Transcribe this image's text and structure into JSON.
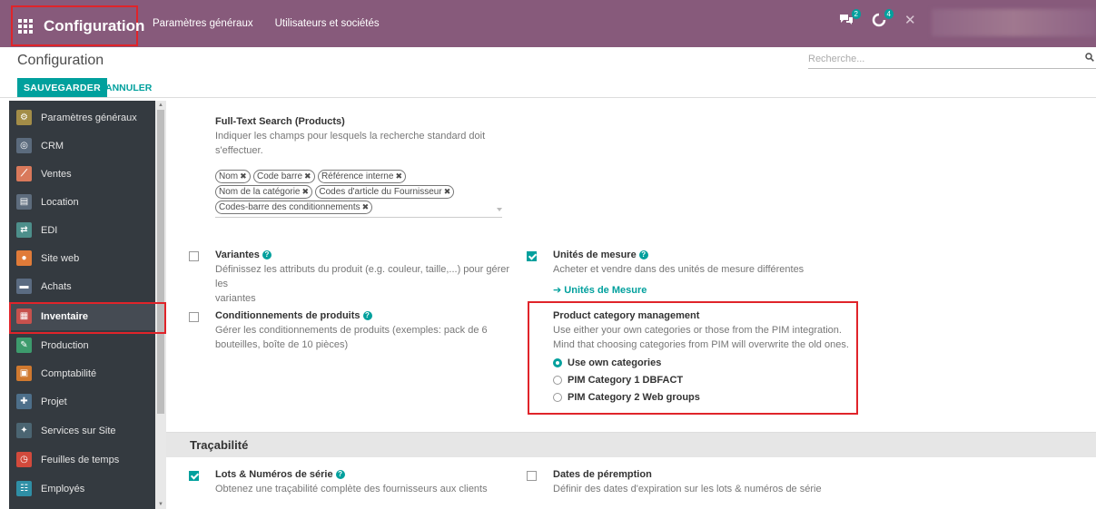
{
  "app": {
    "title": "Configuration",
    "menu": [
      "Paramètres généraux",
      "Utilisateurs et sociétés"
    ],
    "notifications": {
      "messages": "2",
      "activities": "4"
    },
    "accent": "#875a7b",
    "primary": "#00a09d"
  },
  "control_panel": {
    "breadcrumb": "Configuration",
    "search_placeholder": "Recherche...",
    "save_label": "SAUVEGARDER",
    "cancel_label": "ANNULER"
  },
  "sidebar": {
    "items": [
      {
        "label": "Paramètres généraux",
        "icon": "gear-icon",
        "color": "#a38d48"
      },
      {
        "label": "CRM",
        "icon": "crm-icon",
        "color": "#5b6b7d"
      },
      {
        "label": "Ventes",
        "icon": "chart-icon",
        "color": "#d9795b"
      },
      {
        "label": "Location",
        "icon": "rental-icon",
        "color": "#5d6c7d"
      },
      {
        "label": "EDI",
        "icon": "swap-icon",
        "color": "#4d8f8b"
      },
      {
        "label": "Site web",
        "icon": "globe-icon",
        "color": "#e07b39"
      },
      {
        "label": "Achats",
        "icon": "card-icon",
        "color": "#5b6c82"
      },
      {
        "label": "Inventaire",
        "icon": "boxes-icon",
        "color": "#c7514d"
      },
      {
        "label": "Production",
        "icon": "wrench-icon",
        "color": "#3d9b6d"
      },
      {
        "label": "Comptabilité",
        "icon": "invoice-icon",
        "color": "#d0792f"
      },
      {
        "label": "Projet",
        "icon": "puzzle-icon",
        "color": "#4d6f8a"
      },
      {
        "label": "Services sur Site",
        "icon": "worker-icon",
        "color": "#4b6572"
      },
      {
        "label": "Feuilles de temps",
        "icon": "clock-icon",
        "color": "#d24a3c"
      },
      {
        "label": "Employés",
        "icon": "people-icon",
        "color": "#2f8fa6"
      }
    ],
    "active": "Inventaire"
  },
  "settings": {
    "fulltext": {
      "title": "Full-Text Search (Products)",
      "desc_line1": "Indiquer les champs pour lesquels la recherche standard doit",
      "desc_line2": "s'effectuer.",
      "tags": [
        "Nom",
        "Code barre",
        "Référence interne",
        "Nom de la catégorie",
        "Codes d'article du Fournisseur",
        "Codes-barre des conditionnements"
      ]
    },
    "variants": {
      "title": "Variantes",
      "checked": false,
      "desc_line1": "Définissez les attributs du produit (e.g. couleur, taille,...) pour gérer les",
      "desc_line2": "variantes"
    },
    "uom": {
      "title": "Unités de mesure",
      "checked": true,
      "desc": "Acheter et vendre dans des unités de mesure différentes",
      "link": "Unités de Mesure"
    },
    "packaging": {
      "title": "Conditionnements de produits",
      "checked": false,
      "desc_line1": "Gérer les conditionnements de produits (exemples: pack de 6",
      "desc_line2": "bouteilles, boîte de 10 pièces)"
    },
    "pcm": {
      "title": "Product category management",
      "desc_line1": "Use either your own categories or those from the PIM integration.",
      "desc_line2": "Mind that choosing categories from PIM will overwrite the old ones.",
      "options": [
        "Use own categories",
        "PIM Category 1 DBFACT",
        "PIM Category 2 Web groups"
      ],
      "selected": 0
    },
    "traceability_title": "Traçabilité",
    "lots": {
      "title": "Lots & Numéros de série",
      "checked": true,
      "desc": "Obtenez une traçabilité complète des fournisseurs aux clients"
    },
    "expiry": {
      "title": "Dates de péremption",
      "checked": false,
      "desc": "Définir des dates d'expiration sur les lots & numéros de série"
    }
  }
}
